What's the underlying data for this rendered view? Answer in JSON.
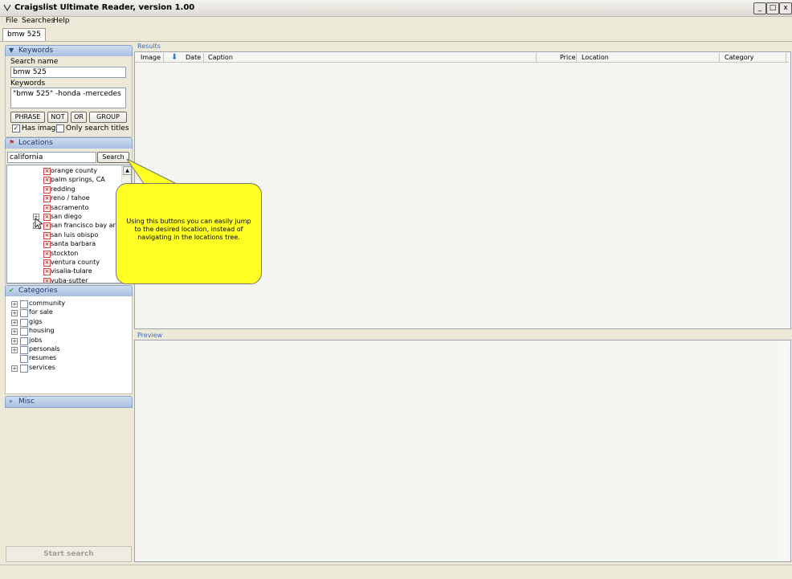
{
  "window": {
    "title": "Craigslist Ultimate Reader, version 1.00",
    "btn_min": "_",
    "btn_max": "□",
    "btn_close": "x"
  },
  "menu": [
    "File",
    "Searches",
    "Help"
  ],
  "tab": {
    "label": "bmw 525"
  },
  "keywords": {
    "header": "Keywords",
    "search_name_label": "Search name",
    "search_name_value": "bmw 525",
    "keywords_label": "Keywords",
    "keywords_value": "\"bmw 525\" -honda -mercedes",
    "buttons": [
      "PHRASE",
      "NOT",
      "OR",
      "GROUP"
    ],
    "has_image_label": "Has image",
    "has_image_checked": true,
    "only_titles_label": "Only search titles",
    "only_titles_checked": false
  },
  "locations": {
    "header": "Locations",
    "search_value": "california",
    "search_button": "Search",
    "items": [
      "orange county",
      "palm springs, CA",
      "redding",
      "reno / tahoe",
      "sacramento",
      "san diego",
      "san francisco bay ar",
      "san luis obispo",
      "santa barbara",
      "stockton",
      "ventura county",
      "visalia-tulare",
      "yuba-sutter"
    ]
  },
  "categories": {
    "header": "Categories",
    "items": [
      "community",
      "for sale",
      "gigs",
      "housing",
      "jobs",
      "personals",
      "resumes",
      "services"
    ]
  },
  "misc": {
    "header": "Misc"
  },
  "start_button": "Start search",
  "results": {
    "label": "Results",
    "columns": [
      "Image",
      "Date",
      "Caption",
      "Price",
      "Location",
      "Category"
    ]
  },
  "preview": {
    "label": "Preview"
  },
  "callout": {
    "text": "Using this buttons you can easily jump to the desired location, instead of navigating in the locations tree."
  }
}
